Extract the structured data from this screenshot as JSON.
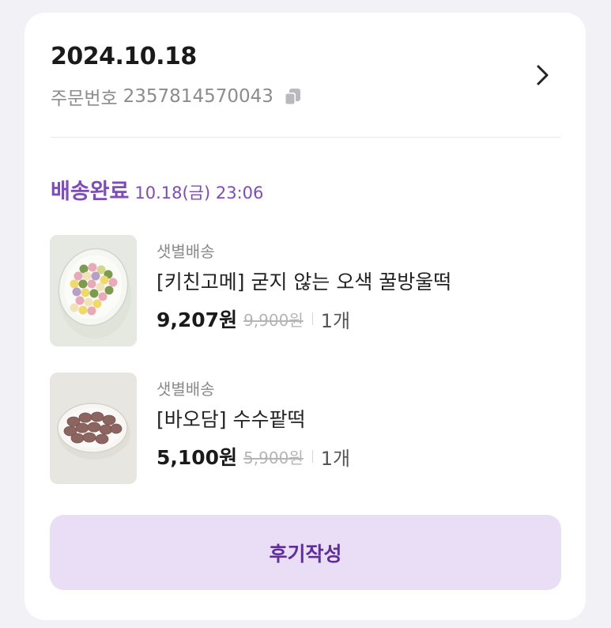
{
  "order": {
    "date": "2024.10.18",
    "number_label": "주문번호",
    "number": "2357814570043"
  },
  "status": {
    "label": "배송완료",
    "time": "10.18(금) 23:06"
  },
  "items": [
    {
      "delivery_type": "샛별배송",
      "name": "[키친고메] 굳지 않는 오색 꿀방울떡",
      "price": "9,207원",
      "original_price": "9,900원",
      "quantity": "1개"
    },
    {
      "delivery_type": "샛별배송",
      "name": "[바오담] 수수팥떡",
      "price": "5,100원",
      "original_price": "5,900원",
      "quantity": "1개"
    }
  ],
  "review_button": {
    "label": "후기작성"
  },
  "icons": {
    "copy": "copy-icon",
    "detail": "chevron-right-icon"
  },
  "colors": {
    "background": "#f2f2f6",
    "card": "#ffffff",
    "accent": "#7e4bbe",
    "button_bg": "#e9def6",
    "button_text": "#5f2e9e"
  }
}
